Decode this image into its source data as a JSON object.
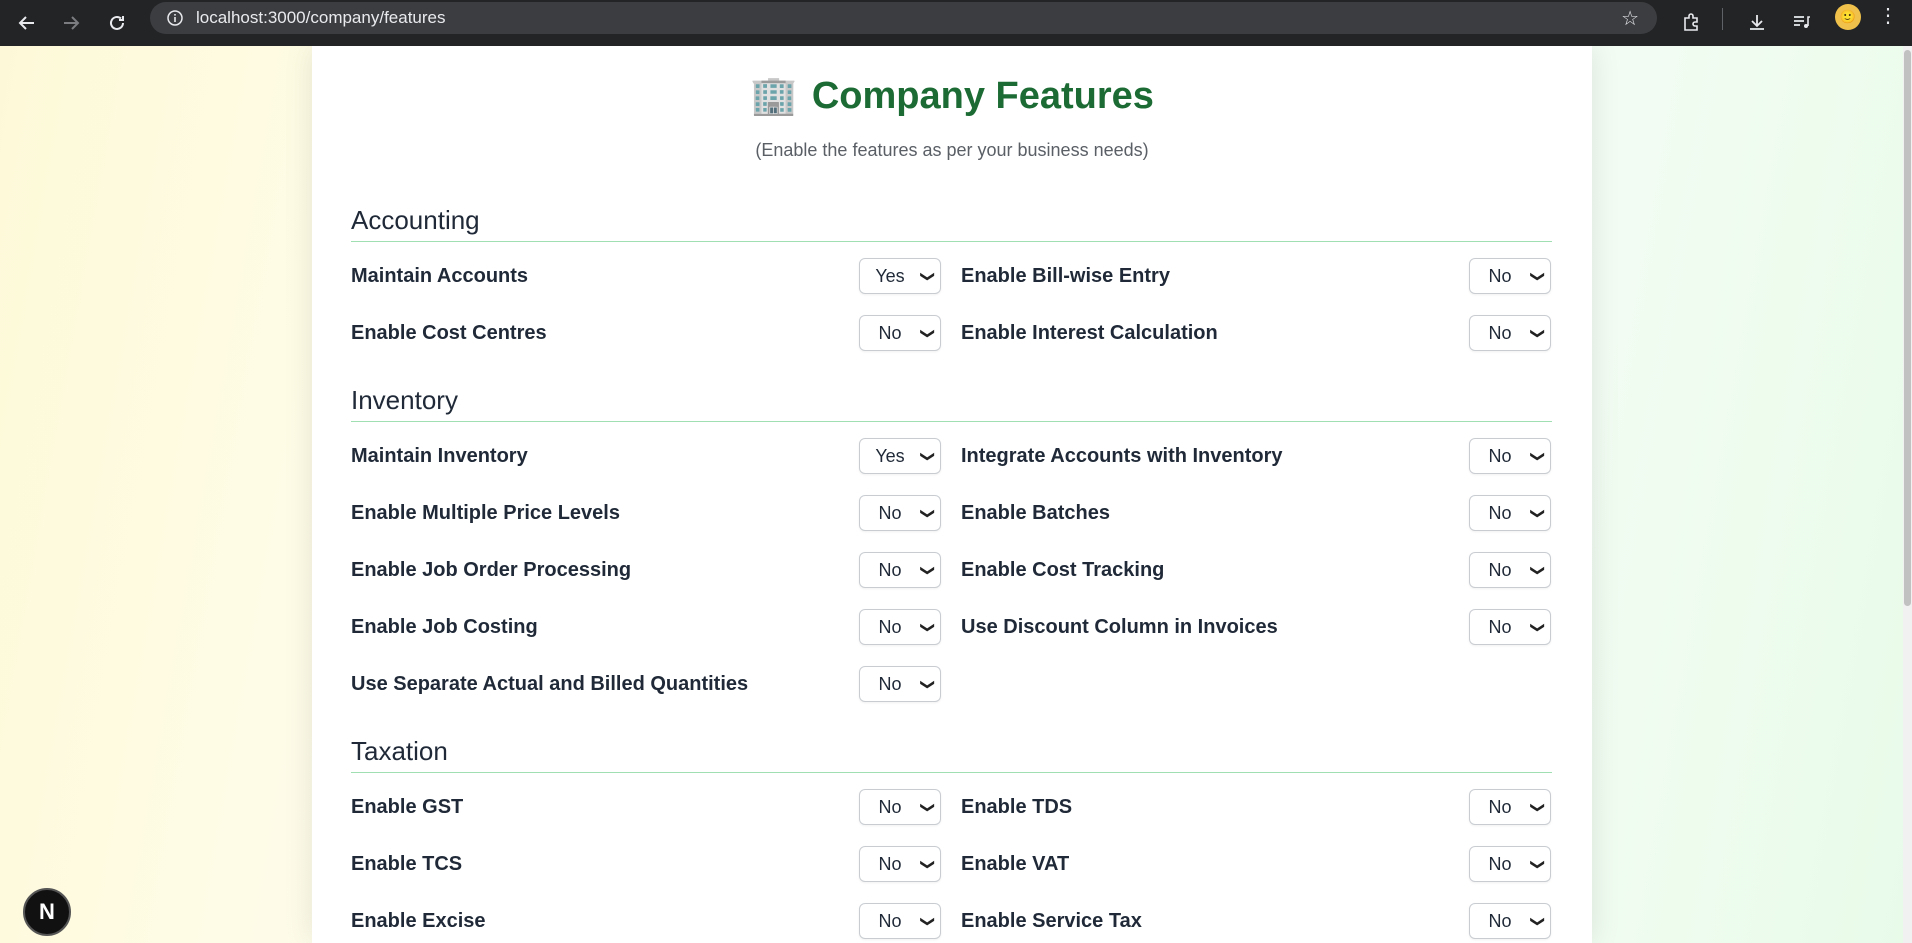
{
  "browser": {
    "url": "localhost:3000/company/features"
  },
  "page": {
    "title_icon": "🏢",
    "title": "Company Features",
    "subtitle": "(Enable the features as per your business needs)"
  },
  "sections": [
    {
      "title": "Accounting",
      "features": [
        {
          "label": "Maintain Accounts",
          "value": "Yes"
        },
        {
          "label": "Enable Bill-wise Entry",
          "value": "No"
        },
        {
          "label": "Enable Cost Centres",
          "value": "No"
        },
        {
          "label": "Enable Interest Calculation",
          "value": "No"
        }
      ]
    },
    {
      "title": "Inventory",
      "features": [
        {
          "label": "Maintain Inventory",
          "value": "Yes"
        },
        {
          "label": "Integrate Accounts with Inventory",
          "value": "No"
        },
        {
          "label": "Enable Multiple Price Levels",
          "value": "No"
        },
        {
          "label": "Enable Batches",
          "value": "No"
        },
        {
          "label": "Enable Job Order Processing",
          "value": "No"
        },
        {
          "label": "Enable Cost Tracking",
          "value": "No"
        },
        {
          "label": "Enable Job Costing",
          "value": "No"
        },
        {
          "label": "Use Discount Column in Invoices",
          "value": "No"
        },
        {
          "label": "Use Separate Actual and Billed Quantities",
          "value": "No"
        }
      ]
    },
    {
      "title": "Taxation",
      "features": [
        {
          "label": "Enable GST",
          "value": "No"
        },
        {
          "label": "Enable TDS",
          "value": "No"
        },
        {
          "label": "Enable TCS",
          "value": "No"
        },
        {
          "label": "Enable VAT",
          "value": "No"
        },
        {
          "label": "Enable Excise",
          "value": "No"
        },
        {
          "label": "Enable Service Tax",
          "value": "No"
        }
      ]
    }
  ],
  "dev_badge": {
    "letter": "N"
  }
}
